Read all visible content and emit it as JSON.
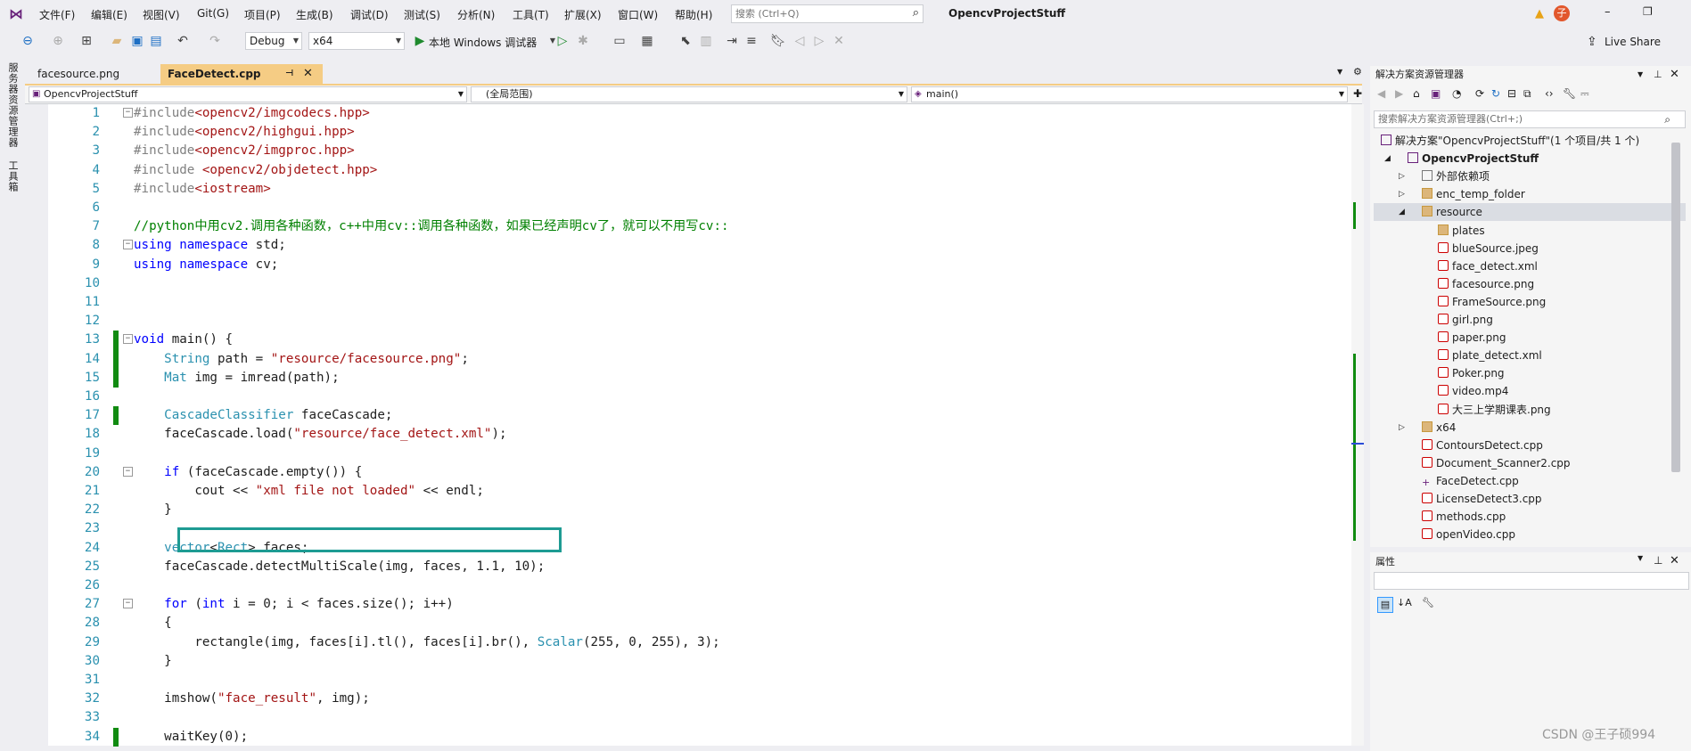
{
  "menu": {
    "items": [
      "文件(F)",
      "编辑(E)",
      "视图(V)",
      "Git(G)",
      "项目(P)",
      "生成(B)",
      "调试(D)",
      "测试(S)",
      "分析(N)",
      "工具(T)",
      "扩展(X)",
      "窗口(W)",
      "帮助(H)"
    ],
    "search_placeholder": "搜索 (Ctrl+Q)",
    "project_title": "OpencvProjectStuff",
    "user_initial": "子",
    "live_share": "Live Share"
  },
  "toolbar": {
    "config": "Debug",
    "platform": "x64",
    "run_label": "本地 Windows 调试器"
  },
  "left_strip": {
    "server_explorer": "服务器资源管理器",
    "toolbox": "工具箱"
  },
  "tabs": [
    {
      "label": "facesource.png"
    },
    {
      "label": "FaceDetect.cpp"
    }
  ],
  "navbar": {
    "project": "OpencvProjectStuff",
    "scope": "(全局范围)",
    "member": "main()"
  },
  "code_lines": [
    {
      "n": "1"
    },
    {
      "n": "2"
    },
    {
      "n": "3"
    },
    {
      "n": "4"
    },
    {
      "n": "5"
    },
    {
      "n": "6"
    },
    {
      "n": "7"
    },
    {
      "n": "8"
    },
    {
      "n": "9"
    },
    {
      "n": "10"
    },
    {
      "n": "11"
    },
    {
      "n": "12"
    },
    {
      "n": "13"
    },
    {
      "n": "14"
    },
    {
      "n": "15"
    },
    {
      "n": "16"
    },
    {
      "n": "17"
    },
    {
      "n": "18"
    },
    {
      "n": "19"
    },
    {
      "n": "20"
    },
    {
      "n": "21"
    },
    {
      "n": "22"
    },
    {
      "n": "23"
    },
    {
      "n": "24"
    },
    {
      "n": "25"
    },
    {
      "n": "26"
    },
    {
      "n": "27"
    },
    {
      "n": "28"
    },
    {
      "n": "29"
    },
    {
      "n": "30"
    },
    {
      "n": "31"
    },
    {
      "n": "32"
    },
    {
      "n": "33"
    },
    {
      "n": "34"
    }
  ],
  "code": {
    "l1": "#include<opencv2/imgcodecs.hpp>",
    "l2": "#include<opencv2/highgui.hpp>",
    "l3": "#include<opencv2/imgproc.hpp>",
    "l4": "#include <opencv2/objdetect.hpp>",
    "l5": "#include<iostream>",
    "l7": "//python中用cv2.调用各种函数，c++中用cv::调用各种函数，如果已经声明cv了，就可以不用写cv::",
    "l8": "using namespace std;",
    "l9": "using namespace cv;",
    "l13": "void main() {",
    "l14": "    String path = \"resource/facesource.png\";",
    "l15": "    Mat img = imread(path);",
    "l17": "    CascadeClassifier faceCascade;",
    "l18": "    faceCascade.load(\"resource/face_detect.xml\");",
    "l20": "    if (faceCascade.empty()) {",
    "l21": "        cout << \"xml file not loaded\" << endl;",
    "l22": "    }",
    "l24": "    vector<Rect> faces;",
    "l25": "    faceCascade.detectMultiScale(img, faces, 1.1, 10);",
    "l27": "    for (int i = 0; i < faces.size(); i++)",
    "l28": "    {",
    "l29": "        rectangle(img, faces[i].tl(), faces[i].br(), Scalar(255, 0, 255), 3);",
    "l30": "    }",
    "l32": "    imshow(\"face_result\", img);",
    "l34": "    waitKey(0);"
  },
  "solution_explorer": {
    "title": "解决方案资源管理器",
    "search_placeholder": "搜索解决方案资源管理器(Ctrl+;)",
    "solution_label": "解决方案\"OpencvProjectStuff\"(1 个项目/共 1 个)",
    "project": "OpencvProjectStuff",
    "items": [
      {
        "label": "外部依赖项"
      },
      {
        "label": "enc_temp_folder"
      },
      {
        "label": "resource"
      },
      {
        "label": "plates"
      },
      {
        "label": "blueSource.jpeg"
      },
      {
        "label": "face_detect.xml"
      },
      {
        "label": "facesource.png"
      },
      {
        "label": "FrameSource.png"
      },
      {
        "label": "girl.png"
      },
      {
        "label": "paper.png"
      },
      {
        "label": "plate_detect.xml"
      },
      {
        "label": "Poker.png"
      },
      {
        "label": "video.mp4"
      },
      {
        "label": "大三上学期课表.png"
      },
      {
        "label": "x64"
      },
      {
        "label": "ContoursDetect.cpp"
      },
      {
        "label": "Document_Scanner2.cpp"
      },
      {
        "label": "FaceDetect.cpp"
      },
      {
        "label": "LicenseDetect3.cpp"
      },
      {
        "label": "methods.cpp"
      },
      {
        "label": "openVideo.cpp"
      }
    ]
  },
  "properties": {
    "title": "属性"
  },
  "watermark": "CSDN @王子硕994",
  "colors": {
    "accent_tab": "#f5cc84",
    "highlight_box": "#1e9b93",
    "change_bar": "#118b11"
  }
}
